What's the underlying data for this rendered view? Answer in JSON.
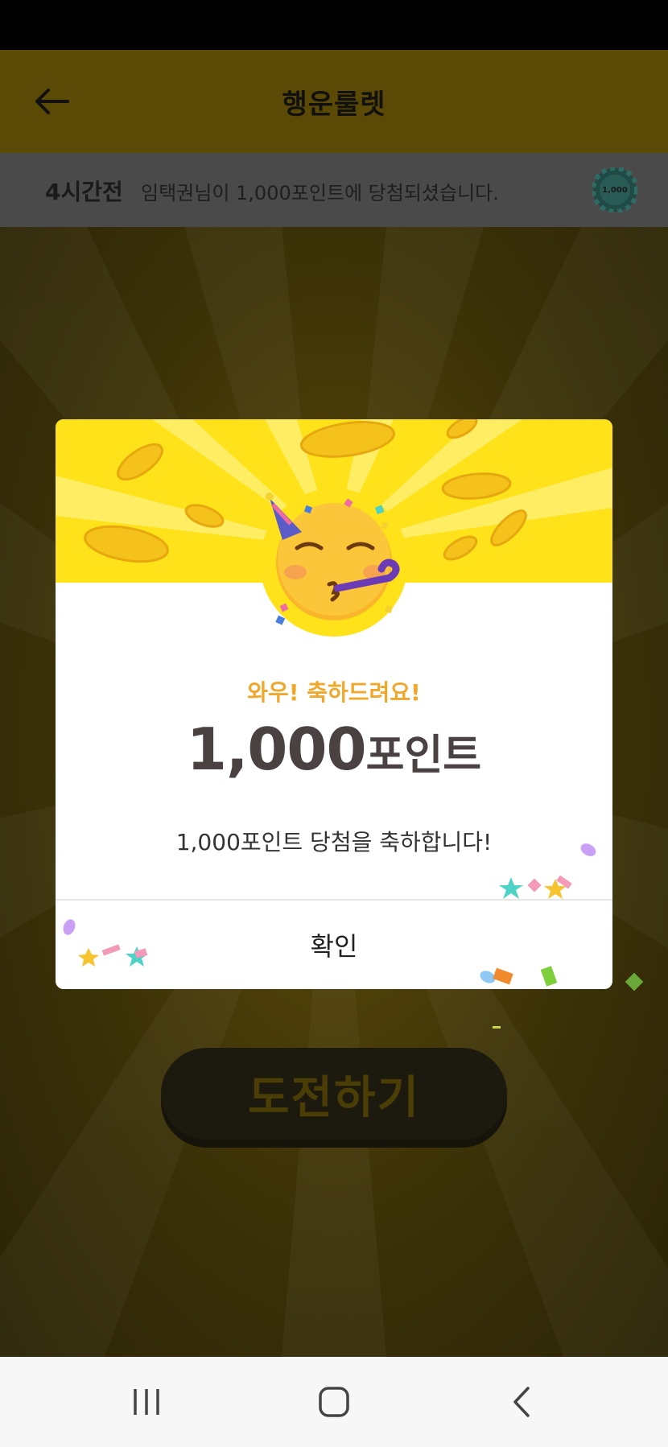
{
  "header": {
    "title": "행운룰렛"
  },
  "ticker": {
    "time": "4시간전",
    "message": "임택권님이 1,000포인트에 당첨되셨습니다.",
    "chip_label": "1,000"
  },
  "main": {
    "challenge_label": "도전하기"
  },
  "dialog": {
    "subtitle": "와우! 축하드려요!",
    "amount_number": "1,000",
    "amount_unit": "포인트",
    "message": "1,000포인트 당첨을 축하합니다!",
    "confirm_label": "확인"
  },
  "colors": {
    "banner_yellow": "#ffe21a",
    "subtitle_orange": "#f0a82c",
    "amount_text": "#4a4142"
  },
  "icons": [
    "back-arrow-icon",
    "point-chip-icon",
    "party-face-icon",
    "recent-apps-icon",
    "home-icon",
    "nav-back-icon"
  ]
}
